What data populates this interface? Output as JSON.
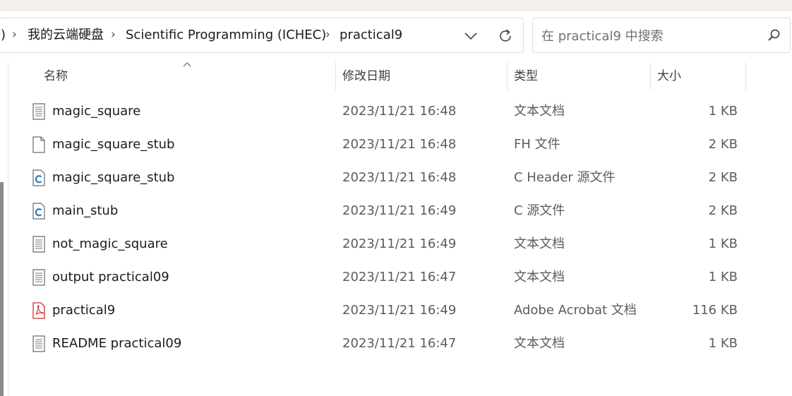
{
  "breadcrumb": {
    "partial_prefix": ")",
    "items": [
      "我的云端硬盘",
      "Scientific Programming (ICHEC)",
      "practical9"
    ]
  },
  "search": {
    "placeholder": "在 practical9 中搜索"
  },
  "columns": {
    "name": "名称",
    "modified": "修改日期",
    "type": "类型",
    "size": "大小"
  },
  "sort": {
    "column": "name",
    "direction": "ascending"
  },
  "files": [
    {
      "name": "magic_square",
      "modified": "2023/11/21 16:48",
      "type": "文本文档",
      "size": "1 KB",
      "icon": "text-file-icon"
    },
    {
      "name": "magic_square_stub",
      "modified": "2023/11/21 16:48",
      "type": "FH 文件",
      "size": "2 KB",
      "icon": "blank-file-icon"
    },
    {
      "name": "magic_square_stub",
      "modified": "2023/11/21 16:48",
      "type": "C Header 源文件",
      "size": "2 KB",
      "icon": "c-source-file-icon"
    },
    {
      "name": "main_stub",
      "modified": "2023/11/21 16:49",
      "type": "C 源文件",
      "size": "2 KB",
      "icon": "c-source-file-icon"
    },
    {
      "name": "not_magic_square",
      "modified": "2023/11/21 16:49",
      "type": "文本文档",
      "size": "1 KB",
      "icon": "text-file-icon"
    },
    {
      "name": "output practical09",
      "modified": "2023/11/21 16:47",
      "type": "文本文档",
      "size": "1 KB",
      "icon": "text-file-icon"
    },
    {
      "name": "practical9",
      "modified": "2023/11/21 16:49",
      "type": "Adobe Acrobat 文档",
      "size": "116 KB",
      "icon": "pdf-file-icon"
    },
    {
      "name": "README practical09",
      "modified": "2023/11/21 16:47",
      "type": "文本文档",
      "size": "1 KB",
      "icon": "text-file-icon"
    }
  ],
  "colors": {
    "pdf_red": "#d32f2f",
    "c_blue": "#2b7bb9",
    "border": "#dcdcdc"
  }
}
